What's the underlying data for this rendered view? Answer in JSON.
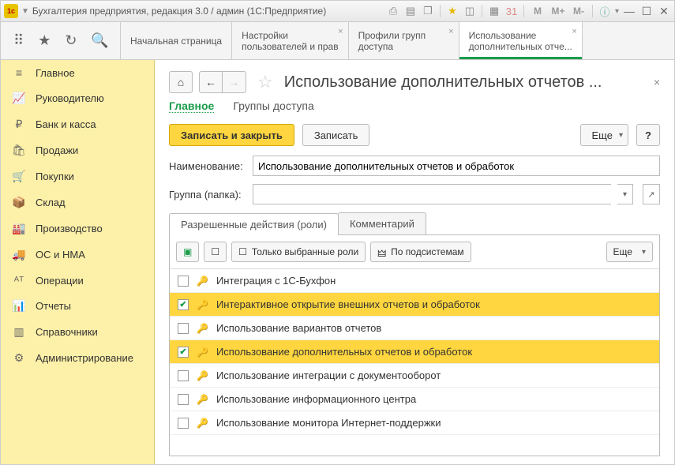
{
  "window": {
    "title": "Бухгалтерия предприятия, редакция 3.0 / админ  (1С:Предприятие)",
    "m1": "M",
    "m2": "M+",
    "m3": "M-"
  },
  "toptabs": {
    "home": "Начальная страница",
    "t1a": "Настройки",
    "t1b": "пользователей и прав",
    "t2a": "Профили групп",
    "t2b": "доступа",
    "t3a": "Использование",
    "t3b": "дополнительных отче..."
  },
  "sidebar": {
    "items": [
      {
        "icon": "≡",
        "label": "Главное"
      },
      {
        "icon": "📈",
        "label": "Руководителю"
      },
      {
        "icon": "₽",
        "label": "Банк и касса"
      },
      {
        "icon": "🛍",
        "label": "Продажи"
      },
      {
        "icon": "🛒",
        "label": "Покупки"
      },
      {
        "icon": "📦",
        "label": "Склад"
      },
      {
        "icon": "🏭",
        "label": "Производство"
      },
      {
        "icon": "🚚",
        "label": "ОС и НМА"
      },
      {
        "icon": "ᴬᵀ",
        "label": "Операции"
      },
      {
        "icon": "📊",
        "label": "Отчеты"
      },
      {
        "icon": "▥",
        "label": "Справочники"
      },
      {
        "icon": "⚙",
        "label": "Администрирование"
      }
    ]
  },
  "page": {
    "title": "Использование дополнительных отчетов ...",
    "subtabs": {
      "main": "Главное",
      "groups": "Группы доступа"
    },
    "save_close": "Записать и закрыть",
    "save": "Записать",
    "more": "Еще",
    "help": "?",
    "name_label": "Наименование:",
    "name_value": "Использование дополнительных отчетов и обработок",
    "group_label": "Группа (папка):",
    "group_value": ""
  },
  "tabs2": {
    "roles": "Разрешенные действия (роли)",
    "comment": "Комментарий"
  },
  "roletoolbar": {
    "only_selected": "Только выбранные роли",
    "by_subsystems": "По подсистемам",
    "more": "Еще"
  },
  "roles": [
    {
      "checked": false,
      "sel": false,
      "label": "Интеграция с 1С-Бухфон"
    },
    {
      "checked": true,
      "sel": true,
      "label": "Интерактивное открытие внешних отчетов и обработок"
    },
    {
      "checked": false,
      "sel": false,
      "label": "Использование вариантов отчетов"
    },
    {
      "checked": true,
      "sel": true,
      "label": "Использование дополнительных отчетов и обработок"
    },
    {
      "checked": false,
      "sel": false,
      "label": "Использование интеграции с документооборот"
    },
    {
      "checked": false,
      "sel": false,
      "label": "Использование информационного центра"
    },
    {
      "checked": false,
      "sel": false,
      "label": "Использование монитора Интернет-поддержки"
    }
  ]
}
